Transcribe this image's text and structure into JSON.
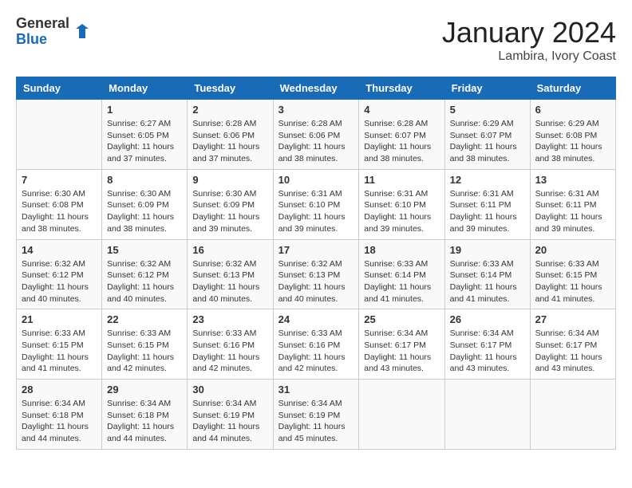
{
  "logo": {
    "general": "General",
    "blue": "Blue"
  },
  "title": "January 2024",
  "location": "Lambira, Ivory Coast",
  "days_of_week": [
    "Sunday",
    "Monday",
    "Tuesday",
    "Wednesday",
    "Thursday",
    "Friday",
    "Saturday"
  ],
  "weeks": [
    [
      {
        "day": "",
        "content": ""
      },
      {
        "day": "1",
        "content": "Sunrise: 6:27 AM\nSunset: 6:05 PM\nDaylight: 11 hours\nand 37 minutes."
      },
      {
        "day": "2",
        "content": "Sunrise: 6:28 AM\nSunset: 6:06 PM\nDaylight: 11 hours\nand 37 minutes."
      },
      {
        "day": "3",
        "content": "Sunrise: 6:28 AM\nSunset: 6:06 PM\nDaylight: 11 hours\nand 38 minutes."
      },
      {
        "day": "4",
        "content": "Sunrise: 6:28 AM\nSunset: 6:07 PM\nDaylight: 11 hours\nand 38 minutes."
      },
      {
        "day": "5",
        "content": "Sunrise: 6:29 AM\nSunset: 6:07 PM\nDaylight: 11 hours\nand 38 minutes."
      },
      {
        "day": "6",
        "content": "Sunrise: 6:29 AM\nSunset: 6:08 PM\nDaylight: 11 hours\nand 38 minutes."
      }
    ],
    [
      {
        "day": "7",
        "content": "Sunrise: 6:30 AM\nSunset: 6:08 PM\nDaylight: 11 hours\nand 38 minutes."
      },
      {
        "day": "8",
        "content": "Sunrise: 6:30 AM\nSunset: 6:09 PM\nDaylight: 11 hours\nand 38 minutes."
      },
      {
        "day": "9",
        "content": "Sunrise: 6:30 AM\nSunset: 6:09 PM\nDaylight: 11 hours\nand 39 minutes."
      },
      {
        "day": "10",
        "content": "Sunrise: 6:31 AM\nSunset: 6:10 PM\nDaylight: 11 hours\nand 39 minutes."
      },
      {
        "day": "11",
        "content": "Sunrise: 6:31 AM\nSunset: 6:10 PM\nDaylight: 11 hours\nand 39 minutes."
      },
      {
        "day": "12",
        "content": "Sunrise: 6:31 AM\nSunset: 6:11 PM\nDaylight: 11 hours\nand 39 minutes."
      },
      {
        "day": "13",
        "content": "Sunrise: 6:31 AM\nSunset: 6:11 PM\nDaylight: 11 hours\nand 39 minutes."
      }
    ],
    [
      {
        "day": "14",
        "content": "Sunrise: 6:32 AM\nSunset: 6:12 PM\nDaylight: 11 hours\nand 40 minutes."
      },
      {
        "day": "15",
        "content": "Sunrise: 6:32 AM\nSunset: 6:12 PM\nDaylight: 11 hours\nand 40 minutes."
      },
      {
        "day": "16",
        "content": "Sunrise: 6:32 AM\nSunset: 6:13 PM\nDaylight: 11 hours\nand 40 minutes."
      },
      {
        "day": "17",
        "content": "Sunrise: 6:32 AM\nSunset: 6:13 PM\nDaylight: 11 hours\nand 40 minutes."
      },
      {
        "day": "18",
        "content": "Sunrise: 6:33 AM\nSunset: 6:14 PM\nDaylight: 11 hours\nand 41 minutes."
      },
      {
        "day": "19",
        "content": "Sunrise: 6:33 AM\nSunset: 6:14 PM\nDaylight: 11 hours\nand 41 minutes."
      },
      {
        "day": "20",
        "content": "Sunrise: 6:33 AM\nSunset: 6:15 PM\nDaylight: 11 hours\nand 41 minutes."
      }
    ],
    [
      {
        "day": "21",
        "content": "Sunrise: 6:33 AM\nSunset: 6:15 PM\nDaylight: 11 hours\nand 41 minutes."
      },
      {
        "day": "22",
        "content": "Sunrise: 6:33 AM\nSunset: 6:15 PM\nDaylight: 11 hours\nand 42 minutes."
      },
      {
        "day": "23",
        "content": "Sunrise: 6:33 AM\nSunset: 6:16 PM\nDaylight: 11 hours\nand 42 minutes."
      },
      {
        "day": "24",
        "content": "Sunrise: 6:33 AM\nSunset: 6:16 PM\nDaylight: 11 hours\nand 42 minutes."
      },
      {
        "day": "25",
        "content": "Sunrise: 6:34 AM\nSunset: 6:17 PM\nDaylight: 11 hours\nand 43 minutes."
      },
      {
        "day": "26",
        "content": "Sunrise: 6:34 AM\nSunset: 6:17 PM\nDaylight: 11 hours\nand 43 minutes."
      },
      {
        "day": "27",
        "content": "Sunrise: 6:34 AM\nSunset: 6:17 PM\nDaylight: 11 hours\nand 43 minutes."
      }
    ],
    [
      {
        "day": "28",
        "content": "Sunrise: 6:34 AM\nSunset: 6:18 PM\nDaylight: 11 hours\nand 44 minutes."
      },
      {
        "day": "29",
        "content": "Sunrise: 6:34 AM\nSunset: 6:18 PM\nDaylight: 11 hours\nand 44 minutes."
      },
      {
        "day": "30",
        "content": "Sunrise: 6:34 AM\nSunset: 6:19 PM\nDaylight: 11 hours\nand 44 minutes."
      },
      {
        "day": "31",
        "content": "Sunrise: 6:34 AM\nSunset: 6:19 PM\nDaylight: 11 hours\nand 45 minutes."
      },
      {
        "day": "",
        "content": ""
      },
      {
        "day": "",
        "content": ""
      },
      {
        "day": "",
        "content": ""
      }
    ]
  ]
}
